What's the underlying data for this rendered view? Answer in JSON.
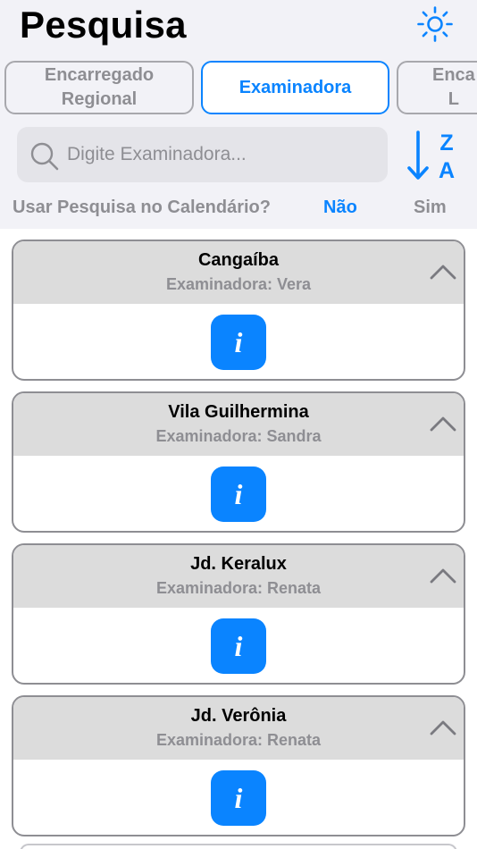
{
  "header": {
    "title": "Pesquisa",
    "theme_icon": "sun-icon"
  },
  "tabs": [
    {
      "label": "Encarregado\nRegional",
      "active": false
    },
    {
      "label": "Examinadora",
      "active": true
    },
    {
      "label": "Enca\nL",
      "active": false
    }
  ],
  "search": {
    "placeholder": "Digite Examinadora...",
    "value": "",
    "icon": "search-icon",
    "sort_icon": "sort-z-a-icon"
  },
  "calendar": {
    "label": "Usar Pesquisa no Calendário?",
    "option_no": "Não",
    "option_yes": "Sim",
    "selected": "Não"
  },
  "cards": [
    {
      "title": "Cangaíba",
      "subtitle": "Examinadora: Vera",
      "info_label": "i"
    },
    {
      "title": "Vila Guilhermina",
      "subtitle": "Examinadora: Sandra",
      "info_label": "i"
    },
    {
      "title": "Jd. Keralux",
      "subtitle": "Examinadora: Renata",
      "info_label": "i"
    },
    {
      "title": "Jd. Verônia",
      "subtitle": "Examinadora: Renata",
      "info_label": "i"
    }
  ],
  "colors": {
    "accent": "#0a84ff",
    "muted": "#8e8e93",
    "card_header": "#dcdcdc",
    "background": "#f2f2f7"
  }
}
